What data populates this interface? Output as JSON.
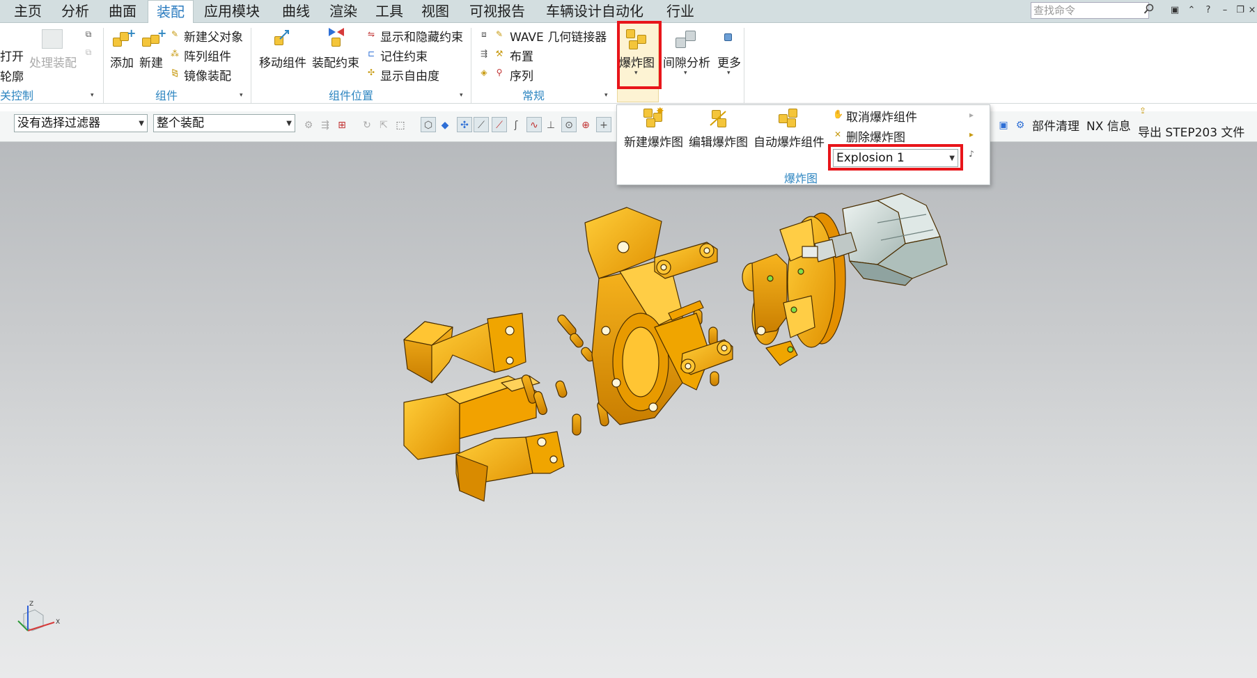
{
  "menu": {
    "tabs": [
      "主页",
      "分析",
      "曲面",
      "装配",
      "应用模块",
      "曲线",
      "渲染",
      "工具",
      "视图",
      "可视报告",
      "车辆设计自动化",
      "行业"
    ],
    "active_index": 3
  },
  "search": {
    "placeholder": "查找命令"
  },
  "ribbon": {
    "col1": {
      "open": "打开",
      "outline": "轮廓",
      "process_assembly": "处理装配"
    },
    "add": "添加",
    "new": "新建",
    "new_parent": "新建父对象",
    "array_component": "阵列组件",
    "mirror_assembly": "镜像装配",
    "move_component": "移动组件",
    "assembly_constraint": "装配约束",
    "show_hide_constraints": "显示和隐藏约束",
    "remember_constraint": "记住约束",
    "show_dof": "显示自由度",
    "wave_linker": "WAVE 几何链接器",
    "arrange": "布置",
    "sequence": "序列",
    "exploded_view": "爆炸图",
    "clearance_analysis": "间隙分析",
    "more": "更多",
    "groups": {
      "control": "关控制",
      "component": "组件",
      "component_position": "组件位置",
      "general": "常规"
    }
  },
  "toolbar": {
    "filter_select": "没有选择过滤器",
    "scope_select": "整个装配",
    "part_cleanup": "部件清理",
    "nx_info": "NX 信息",
    "export_step": "导出 STEP203 文件"
  },
  "explode_popup": {
    "new_explosion": "新建爆炸图",
    "edit_explosion": "编辑爆炸图",
    "auto_explode": "自动爆炸组件",
    "unexplode": "取消爆炸组件",
    "delete_explosion": "删除爆炸图",
    "explosion_select": "Explosion 1",
    "group_label": "爆炸图"
  },
  "triad": {
    "z": "Z",
    "x": "X"
  },
  "colors": {
    "highlight": "#e8151a",
    "accent": "#2e86c1",
    "part": "#f5a800"
  }
}
